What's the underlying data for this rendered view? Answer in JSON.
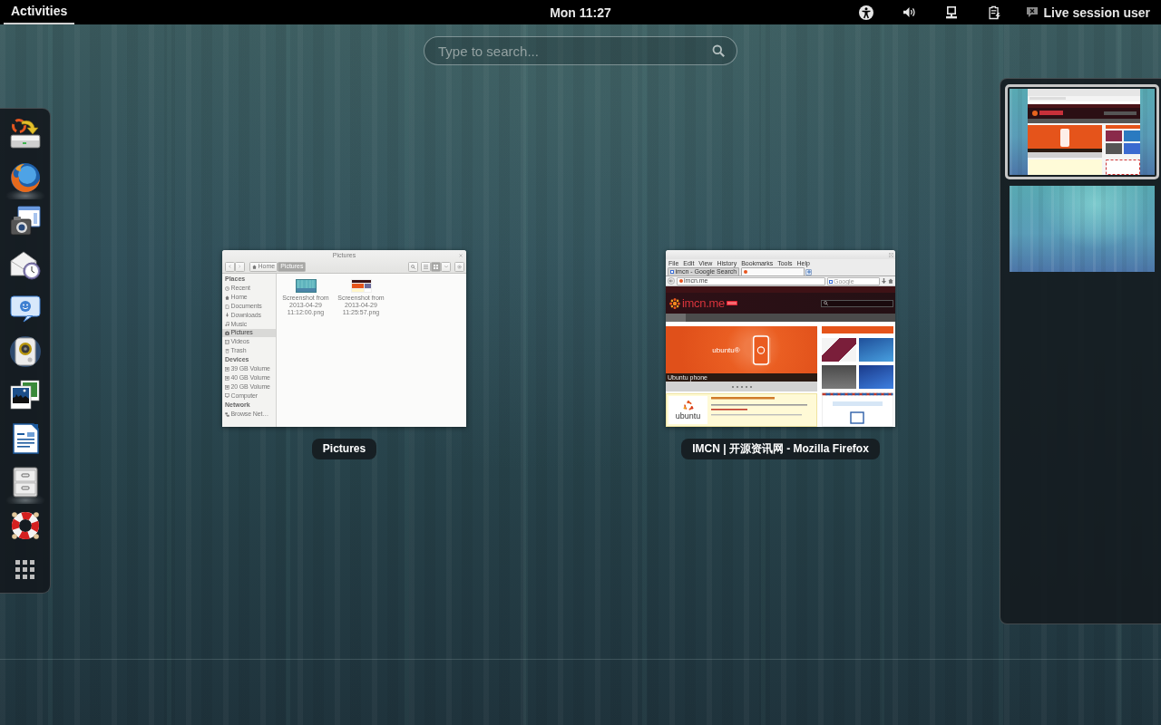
{
  "top_bar": {
    "activities": {
      "label": "Activities",
      "selected": true
    },
    "clock": "Mon 11:27",
    "status_icons": [
      {
        "kind": "accessibility"
      },
      {
        "kind": "volume"
      },
      {
        "kind": "network"
      },
      {
        "kind": "power"
      }
    ],
    "user_menu": {
      "label": "Live session user"
    }
  },
  "search": {
    "placeholder": "Type to search..."
  },
  "dash": {
    "items": [
      {
        "kind": "installer",
        "running": false
      },
      {
        "kind": "browser",
        "running": true
      },
      {
        "kind": "screenshot",
        "running": false
      },
      {
        "kind": "mail-clock",
        "running": false
      },
      {
        "kind": "chat",
        "running": false
      },
      {
        "kind": "speaker",
        "running": false
      },
      {
        "kind": "photos",
        "running": false
      },
      {
        "kind": "document",
        "running": false
      },
      {
        "kind": "file-cabinet",
        "running": true
      },
      {
        "kind": "lifebuoy",
        "running": false
      },
      {
        "kind": "app-grid",
        "running": false
      }
    ]
  },
  "windows": [
    {
      "kind": "file-manager",
      "caption": "Pictures",
      "title": "Pictures",
      "path": [
        {
          "label": "Home",
          "kind": "home",
          "selected": false
        },
        {
          "label": "Pictures",
          "kind": "folder",
          "selected": true
        }
      ],
      "view_buttons": [
        {
          "kind": "list",
          "selected": false
        },
        {
          "kind": "grid",
          "selected": true
        }
      ],
      "sidebar": [
        {
          "heading": "Places",
          "items": [
            {
              "label": "Recent",
              "kind": "recent",
              "selected": false
            },
            {
              "label": "Home",
              "kind": "home",
              "selected": false
            },
            {
              "label": "Documents",
              "kind": "documents",
              "selected": false
            },
            {
              "label": "Downloads",
              "kind": "downloads",
              "selected": false
            },
            {
              "label": "Music",
              "kind": "music",
              "selected": false
            },
            {
              "label": "Pictures",
              "kind": "pictures",
              "selected": true
            },
            {
              "label": "Videos",
              "kind": "videos",
              "selected": false
            },
            {
              "label": "Trash",
              "kind": "trash",
              "selected": false
            }
          ]
        },
        {
          "heading": "Devices",
          "items": [
            {
              "label": "39 GB Volume",
              "kind": "drive",
              "selected": false
            },
            {
              "label": "40 GB Volume",
              "kind": "drive",
              "selected": false
            },
            {
              "label": "20 GB Volume",
              "kind": "drive",
              "selected": false
            },
            {
              "label": "Computer",
              "kind": "computer",
              "selected": false
            }
          ]
        },
        {
          "heading": "Network",
          "items": [
            {
              "label": "Browse Net…",
              "kind": "network",
              "selected": false
            }
          ]
        }
      ],
      "files": [
        {
          "name": "Screenshot from 2013-04-29 11:12:00.png",
          "kind": "wallpaper"
        },
        {
          "name": "Screenshot from 2013-04-29 11:25:57.png",
          "kind": "webpage"
        }
      ]
    },
    {
      "kind": "browser",
      "caption": "IMCN | 开源资讯网 - Mozilla Firefox",
      "menu": [
        "File",
        "Edit",
        "View",
        "History",
        "Bookmarks",
        "Tools",
        "Help"
      ],
      "tabs": [
        {
          "label": "imcn - Google Search",
          "kind": "search",
          "selected": false
        },
        {
          "kind": "site",
          "selected": true
        }
      ],
      "url": "imcn.me",
      "search_box": {
        "placeholder": "Google"
      },
      "page": {
        "logo": "imcn.me",
        "banner_text": "ubuntu®",
        "banner_caption": "Ubuntu phone",
        "article_logo": "ubuntu"
      }
    }
  ],
  "workspaces": [
    {
      "selected": true,
      "kind": "browser"
    },
    {
      "selected": false,
      "kind": "empty"
    }
  ]
}
